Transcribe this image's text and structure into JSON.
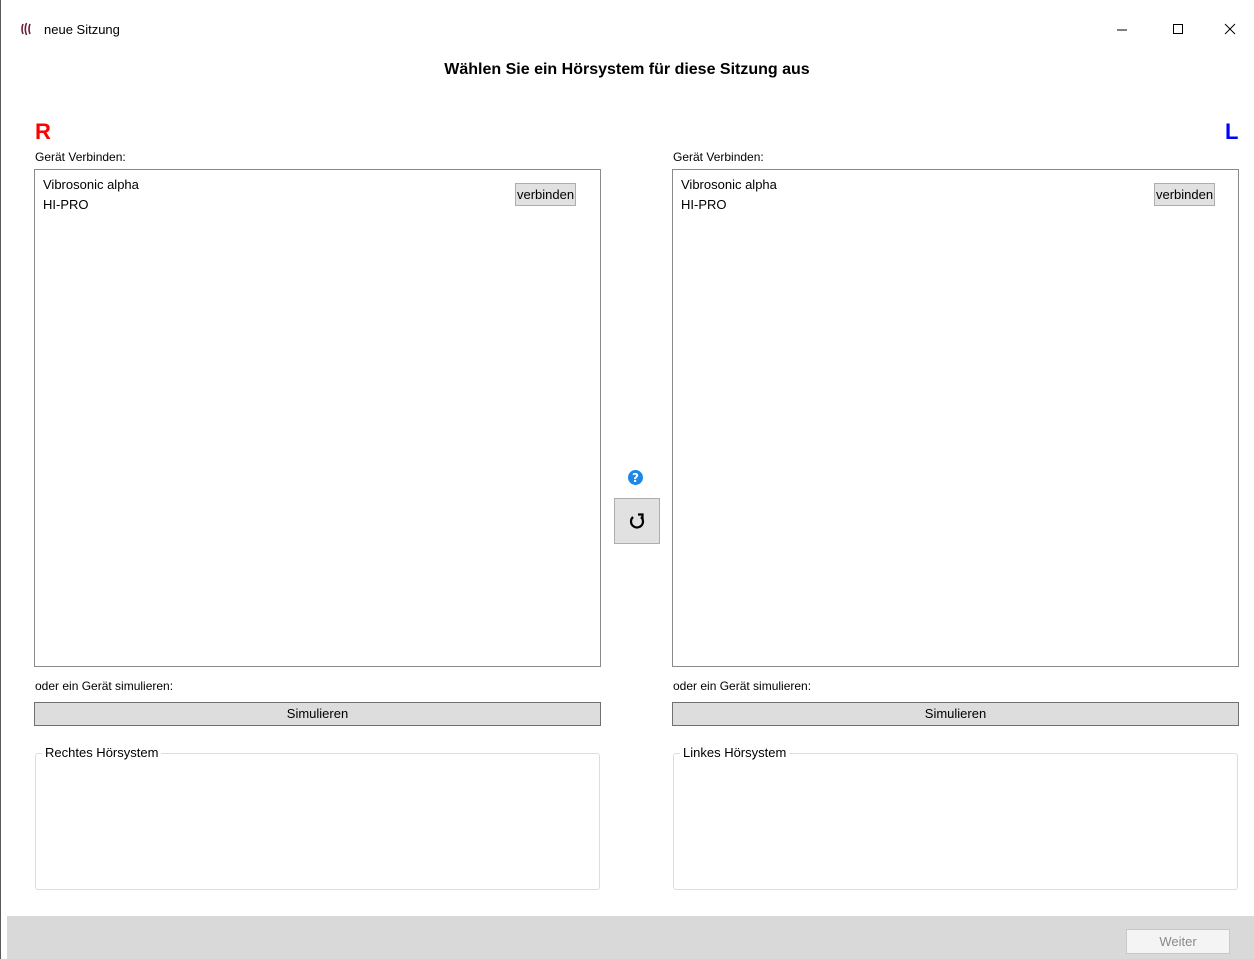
{
  "window": {
    "title": "neue Sitzung",
    "icon": "sound-waves-icon",
    "controls": [
      "minimize-icon",
      "maximize-icon",
      "close-icon"
    ]
  },
  "heading": "Wählen Sie ein Hörsystem für diese Sitzung aus",
  "right": {
    "side_label": "R",
    "side_color": "#ff0000",
    "connect_label": "Gerät Verbinden:",
    "devices": [
      "Vibrosonic alpha",
      "HI-PRO"
    ],
    "connect_button": "verbinden",
    "simulate_label": "oder ein Gerät simulieren:",
    "simulate_button": "Simulieren",
    "group_title": "Rechtes Hörsystem"
  },
  "left": {
    "side_label": "L",
    "side_color": "#0000ff",
    "connect_label": "Gerät Verbinden:",
    "devices": [
      "Vibrosonic alpha",
      "HI-PRO"
    ],
    "connect_button": "verbinden",
    "simulate_label": "oder ein Gerät simulieren:",
    "simulate_button": "Simulieren",
    "group_title": "Linkes Hörsystem"
  },
  "center": {
    "help_icon": "question-circle-icon",
    "help_color": "#1e88e5",
    "refresh_icon": "refresh-icon"
  },
  "footer": {
    "next_button": "Weiter",
    "next_enabled": false
  }
}
